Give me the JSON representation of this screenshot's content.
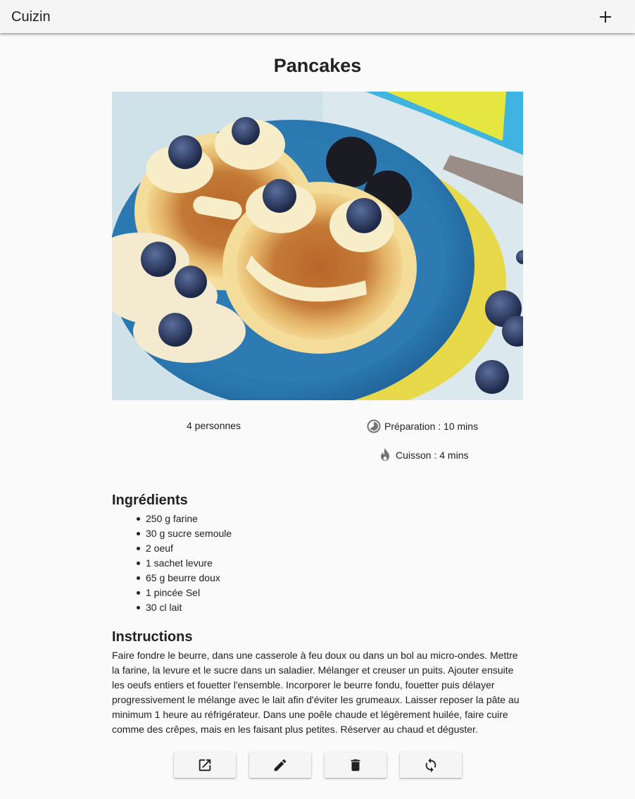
{
  "appbar": {
    "title": "Cuizin",
    "add_icon": "plus-icon"
  },
  "recipe": {
    "title": "Pancakes",
    "image_alt": "Pancakes",
    "servings": "4 personnes",
    "preparation": "Préparation : 10 mins",
    "cooking": "Cuisson : 4 mins",
    "ingredients_heading": "Ingrédients",
    "ingredients": [
      "250 g farine",
      "30 g sucre semoule",
      "2 oeuf",
      "1 sachet levure",
      "65 g beurre doux",
      "1 pincée Sel",
      "30 cl lait"
    ],
    "instructions_heading": "Instructions",
    "instructions": "Faire fondre le beurre, dans une casserole à feu doux ou dans un bol au micro-ondes. Mettre la farine, la levure et le sucre dans un saladier. Mélanger et creuser un puits. Ajouter ensuite les oeufs entiers et fouetter l'ensemble. Incorporer le beurre fondu, fouetter puis délayer progressivement le mélange avec le lait afin d'éviter les grumeaux. Laisser reposer la pâte au minimum 1 heure au réfrigérateur. Dans une poêle chaude et légèrement huilée, faire cuire comme des crêpes, mais en les faisant plus petites. Réserver au chaud et déguster."
  },
  "actions": [
    {
      "icon": "open-external-icon"
    },
    {
      "icon": "edit-icon"
    },
    {
      "icon": "delete-icon"
    },
    {
      "icon": "refresh-icon"
    }
  ],
  "colors": {
    "appbar": "#f5f5f5",
    "background": "#fafafa",
    "text": "#212121",
    "icon": "#757575"
  }
}
